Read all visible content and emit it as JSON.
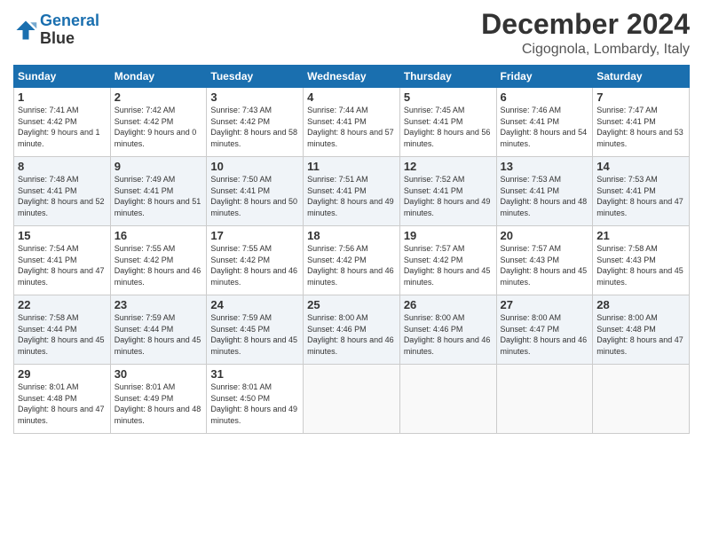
{
  "header": {
    "logo_line1": "General",
    "logo_line2": "Blue",
    "title": "December 2024",
    "location": "Cigognola, Lombardy, Italy"
  },
  "columns": [
    "Sunday",
    "Monday",
    "Tuesday",
    "Wednesday",
    "Thursday",
    "Friday",
    "Saturday"
  ],
  "weeks": [
    [
      {
        "day": "1",
        "sunrise": "7:41 AM",
        "sunset": "4:42 PM",
        "daylight": "9 hours and 1 minute."
      },
      {
        "day": "2",
        "sunrise": "7:42 AM",
        "sunset": "4:42 PM",
        "daylight": "9 hours and 0 minutes."
      },
      {
        "day": "3",
        "sunrise": "7:43 AM",
        "sunset": "4:42 PM",
        "daylight": "8 hours and 58 minutes."
      },
      {
        "day": "4",
        "sunrise": "7:44 AM",
        "sunset": "4:41 PM",
        "daylight": "8 hours and 57 minutes."
      },
      {
        "day": "5",
        "sunrise": "7:45 AM",
        "sunset": "4:41 PM",
        "daylight": "8 hours and 56 minutes."
      },
      {
        "day": "6",
        "sunrise": "7:46 AM",
        "sunset": "4:41 PM",
        "daylight": "8 hours and 54 minutes."
      },
      {
        "day": "7",
        "sunrise": "7:47 AM",
        "sunset": "4:41 PM",
        "daylight": "8 hours and 53 minutes."
      }
    ],
    [
      {
        "day": "8",
        "sunrise": "7:48 AM",
        "sunset": "4:41 PM",
        "daylight": "8 hours and 52 minutes."
      },
      {
        "day": "9",
        "sunrise": "7:49 AM",
        "sunset": "4:41 PM",
        "daylight": "8 hours and 51 minutes."
      },
      {
        "day": "10",
        "sunrise": "7:50 AM",
        "sunset": "4:41 PM",
        "daylight": "8 hours and 50 minutes."
      },
      {
        "day": "11",
        "sunrise": "7:51 AM",
        "sunset": "4:41 PM",
        "daylight": "8 hours and 49 minutes."
      },
      {
        "day": "12",
        "sunrise": "7:52 AM",
        "sunset": "4:41 PM",
        "daylight": "8 hours and 49 minutes."
      },
      {
        "day": "13",
        "sunrise": "7:53 AM",
        "sunset": "4:41 PM",
        "daylight": "8 hours and 48 minutes."
      },
      {
        "day": "14",
        "sunrise": "7:53 AM",
        "sunset": "4:41 PM",
        "daylight": "8 hours and 47 minutes."
      }
    ],
    [
      {
        "day": "15",
        "sunrise": "7:54 AM",
        "sunset": "4:41 PM",
        "daylight": "8 hours and 47 minutes."
      },
      {
        "day": "16",
        "sunrise": "7:55 AM",
        "sunset": "4:42 PM",
        "daylight": "8 hours and 46 minutes."
      },
      {
        "day": "17",
        "sunrise": "7:55 AM",
        "sunset": "4:42 PM",
        "daylight": "8 hours and 46 minutes."
      },
      {
        "day": "18",
        "sunrise": "7:56 AM",
        "sunset": "4:42 PM",
        "daylight": "8 hours and 46 minutes."
      },
      {
        "day": "19",
        "sunrise": "7:57 AM",
        "sunset": "4:42 PM",
        "daylight": "8 hours and 45 minutes."
      },
      {
        "day": "20",
        "sunrise": "7:57 AM",
        "sunset": "4:43 PM",
        "daylight": "8 hours and 45 minutes."
      },
      {
        "day": "21",
        "sunrise": "7:58 AM",
        "sunset": "4:43 PM",
        "daylight": "8 hours and 45 minutes."
      }
    ],
    [
      {
        "day": "22",
        "sunrise": "7:58 AM",
        "sunset": "4:44 PM",
        "daylight": "8 hours and 45 minutes."
      },
      {
        "day": "23",
        "sunrise": "7:59 AM",
        "sunset": "4:44 PM",
        "daylight": "8 hours and 45 minutes."
      },
      {
        "day": "24",
        "sunrise": "7:59 AM",
        "sunset": "4:45 PM",
        "daylight": "8 hours and 45 minutes."
      },
      {
        "day": "25",
        "sunrise": "8:00 AM",
        "sunset": "4:46 PM",
        "daylight": "8 hours and 46 minutes."
      },
      {
        "day": "26",
        "sunrise": "8:00 AM",
        "sunset": "4:46 PM",
        "daylight": "8 hours and 46 minutes."
      },
      {
        "day": "27",
        "sunrise": "8:00 AM",
        "sunset": "4:47 PM",
        "daylight": "8 hours and 46 minutes."
      },
      {
        "day": "28",
        "sunrise": "8:00 AM",
        "sunset": "4:48 PM",
        "daylight": "8 hours and 47 minutes."
      }
    ],
    [
      {
        "day": "29",
        "sunrise": "8:01 AM",
        "sunset": "4:48 PM",
        "daylight": "8 hours and 47 minutes."
      },
      {
        "day": "30",
        "sunrise": "8:01 AM",
        "sunset": "4:49 PM",
        "daylight": "8 hours and 48 minutes."
      },
      {
        "day": "31",
        "sunrise": "8:01 AM",
        "sunset": "4:50 PM",
        "daylight": "8 hours and 49 minutes."
      },
      null,
      null,
      null,
      null
    ]
  ]
}
